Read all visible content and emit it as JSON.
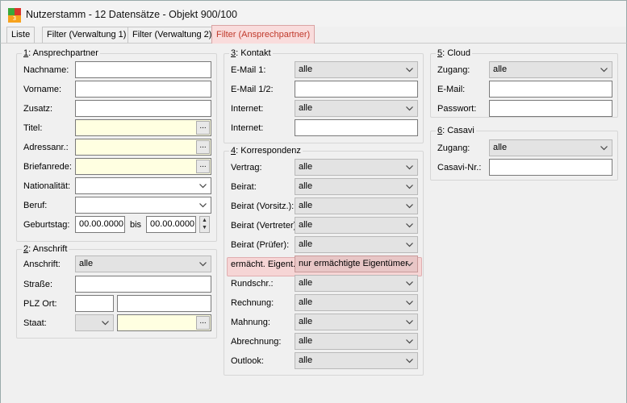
{
  "window": {
    "title": "Nutzerstamm - 12 Datensätze - Objekt 900/100"
  },
  "tabs": [
    "Liste",
    "Filter (Verwaltung 1)",
    "Filter (Verwaltung 2)",
    "Filter (Ansprechpartner)"
  ],
  "ansprechpartner": {
    "num": "1",
    "title": ": Ansprechpartner",
    "labels": {
      "nachname": "Nachname:",
      "vorname": "Vorname:",
      "zusatz": "Zusatz:",
      "titel": "Titel:",
      "adressanr": "Adressanr.:",
      "briefanrede": "Briefanrede:",
      "nationalitaet": "Nationalität:",
      "beruf": "Beruf:",
      "geburtstag": "Geburtstag:",
      "bis": "bis"
    },
    "geburtstag_from": "00.00.0000",
    "geburtstag_to": "00.00.0000"
  },
  "anschrift": {
    "num": "2",
    "title": ": Anschrift",
    "labels": {
      "anschrift": "Anschrift:",
      "strasse": "Straße:",
      "plz_ort": "PLZ Ort:",
      "staat": "Staat:"
    },
    "anschrift_value": "alle"
  },
  "kontakt": {
    "num": "3",
    "title": ": Kontakt",
    "labels": {
      "email1": "E-Mail 1:",
      "email12": "E-Mail 1/2:",
      "internet1": "Internet:",
      "internet2": "Internet:"
    },
    "email1_value": "alle",
    "internet_value": "alle"
  },
  "korrespondenz": {
    "num": "4",
    "title": ": Korrespondenz",
    "rows": [
      {
        "label": "Vertrag:",
        "value": "alle"
      },
      {
        "label": "Beirat:",
        "value": "alle"
      },
      {
        "label": "Beirat (Vorsitz.):",
        "value": "alle"
      },
      {
        "label": "Beirat (Vertreter):",
        "value": "alle"
      },
      {
        "label": "Beirat (Prüfer):",
        "value": "alle"
      },
      {
        "label": "ermächt. Eigent.:",
        "value": "nur ermächtigte Eigentümer"
      },
      {
        "label": "Rundschr.:",
        "value": "alle"
      },
      {
        "label": "Rechnung:",
        "value": "alle"
      },
      {
        "label": "Mahnung:",
        "value": "alle"
      },
      {
        "label": "Abrechnung:",
        "value": "alle"
      },
      {
        "label": "Outlook:",
        "value": "alle"
      }
    ]
  },
  "cloud": {
    "num": "5",
    "title": ": Cloud",
    "labels": {
      "zugang": "Zugang:",
      "email": "E-Mail:",
      "passwort": "Passwort:"
    },
    "zugang_value": "alle"
  },
  "casavi": {
    "num": "6",
    "title": ": Casavi",
    "labels": {
      "zugang": "Zugang:",
      "casavi_nr": "Casavi-Nr.:"
    },
    "zugang_value": "alle"
  },
  "ellipsis": "...",
  "colors": {
    "highlight": "#f6d5d5",
    "yellow_field": "#ffffe1",
    "active_tab_text": "#c0392b"
  }
}
